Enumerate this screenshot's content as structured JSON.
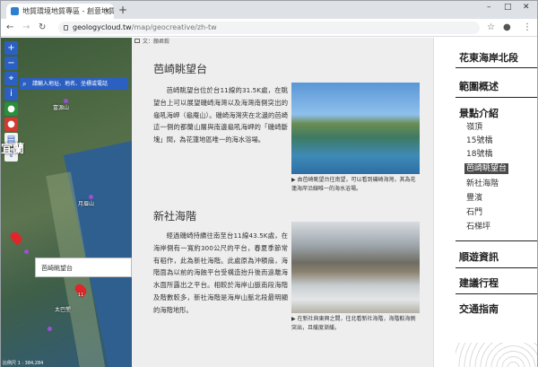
{
  "browser": {
    "tab_title": "地質環境地質專區 - 創意地質平台",
    "address_host": "geologycloud.tw",
    "address_path": "/map/geocreative/zh-tw",
    "window_controls": [
      "–",
      "□",
      "✕"
    ]
  },
  "map": {
    "search_placeholder": "請輸入地址、地名、坐標或電話",
    "region_label": "宜蘭",
    "place_labels": [
      "富源山",
      "月眉山",
      "太巴塱"
    ],
    "popup_label": "芭崎眺望台",
    "marker_numbers": [
      "11"
    ],
    "coords_text": "比例尺 1 : 384,284",
    "tools": [
      "+",
      "−",
      "⌖",
      "i"
    ],
    "colors": {
      "tool_blue": "#2b5fc2",
      "marker_red": "#e0262b"
    }
  },
  "content": {
    "meta_text": "文：顏君毅",
    "sections": [
      {
        "title": "芭崎眺望台",
        "body": "芭崎眺望台位於台11線的31.5K處，在眺望台上可以展望磯崎海灣以及海灣南側突出的龜吼海岬（龜庵山）。磯崎海灣夾在北邊的芭崎這一側的都蘭山層與南邊龜吼海岬的「磯崎斷塊」間，為花蓮地區唯一的海水浴場。",
        "caption": "▶ 由芭崎眺望台往南望，可以看到磯崎海灣，其為花蓮海岸沿線唯一的海水浴場。"
      },
      {
        "title": "新社海階",
        "body": "經過磯崎持續往南至台11線43.5K處，在海岸側有一寬約300公尺的平台，春夏季節常有稻作，此為新社海階。此處原為沖積扇，海階面為以前的海蝕平台受構造抬升後而遠離海水面所露出之平台。相較於海岸山脈南段海階及階數較多，新社海階是海岸山脈北段最明顯的海階地形。",
        "caption": "▶ 在新社與東興之間，往北看新社海階，海階較海側突出，且緩度漸緩。"
      }
    ]
  },
  "nav": {
    "headings": [
      "花東海岸北段",
      "範圍概述",
      "景點介紹",
      "順遊資訊",
      "建議行程",
      "交通指南"
    ],
    "spots": [
      "嶺頂",
      "15號橋",
      "18號橋",
      "芭崎眺望台",
      "新社海階",
      "豐濱",
      "石門",
      "石梯坪"
    ],
    "active_spot": "芭崎眺望台"
  }
}
